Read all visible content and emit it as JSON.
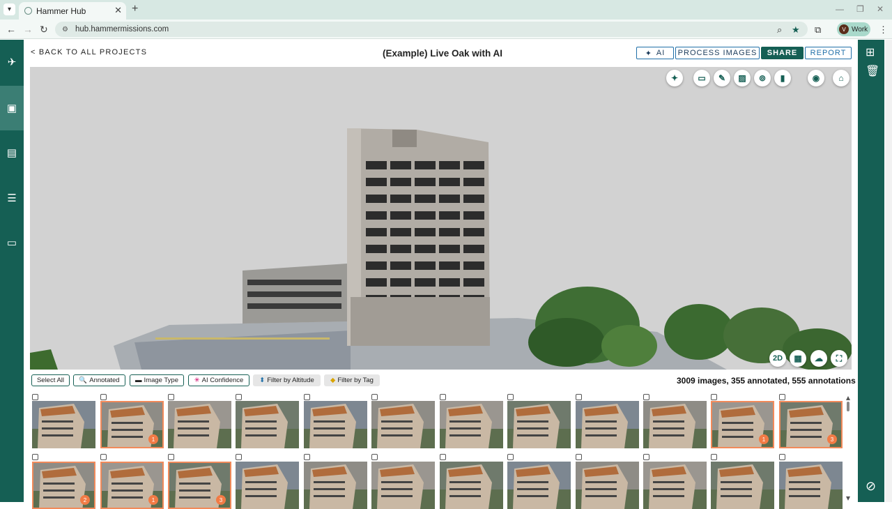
{
  "browser": {
    "tab_title": "Hammer Hub",
    "url": "hub.hammermissions.com",
    "profile_label": "Work",
    "profile_initial": "V"
  },
  "header": {
    "back_label": "< BACK TO ALL PROJECTS",
    "title": "(Example) Live Oak with AI",
    "buttons": {
      "ai": "AI",
      "process": "PROCESS IMAGES",
      "share": "SHARE",
      "report": "REPORT"
    }
  },
  "viewport": {
    "mode_label": "2D"
  },
  "filters": {
    "select_all": "Select All",
    "annotated": "Annotated",
    "image_type": "Image Type",
    "ai_confidence": "AI Confidence",
    "altitude": "Filter by Altitude",
    "tag": "Filter by Tag"
  },
  "stats": "3009 images, 355 annotated, 555 annotations",
  "thumbnails": {
    "row1": [
      {
        "annotated": false,
        "badge": null
      },
      {
        "annotated": true,
        "badge": "1"
      },
      {
        "annotated": false,
        "badge": null
      },
      {
        "annotated": false,
        "badge": null
      },
      {
        "annotated": false,
        "badge": null
      },
      {
        "annotated": false,
        "badge": null
      },
      {
        "annotated": false,
        "badge": null
      },
      {
        "annotated": false,
        "badge": null
      },
      {
        "annotated": false,
        "badge": null
      },
      {
        "annotated": false,
        "badge": null
      },
      {
        "annotated": true,
        "badge": "1"
      },
      {
        "annotated": true,
        "badge": "3"
      }
    ],
    "row2": [
      {
        "annotated": true,
        "badge": "2"
      },
      {
        "annotated": true,
        "badge": "1"
      },
      {
        "annotated": true,
        "badge": "3"
      },
      {
        "annotated": false,
        "badge": null
      },
      {
        "annotated": false,
        "badge": null
      },
      {
        "annotated": false,
        "badge": null
      },
      {
        "annotated": false,
        "badge": null
      },
      {
        "annotated": false,
        "badge": null
      },
      {
        "annotated": false,
        "badge": null
      },
      {
        "annotated": false,
        "badge": null
      },
      {
        "annotated": false,
        "badge": null
      },
      {
        "annotated": false,
        "badge": null
      }
    ]
  },
  "colors": {
    "brand": "#155f54",
    "annotated_border": "#f28a5a",
    "badge": "#f27b45"
  }
}
